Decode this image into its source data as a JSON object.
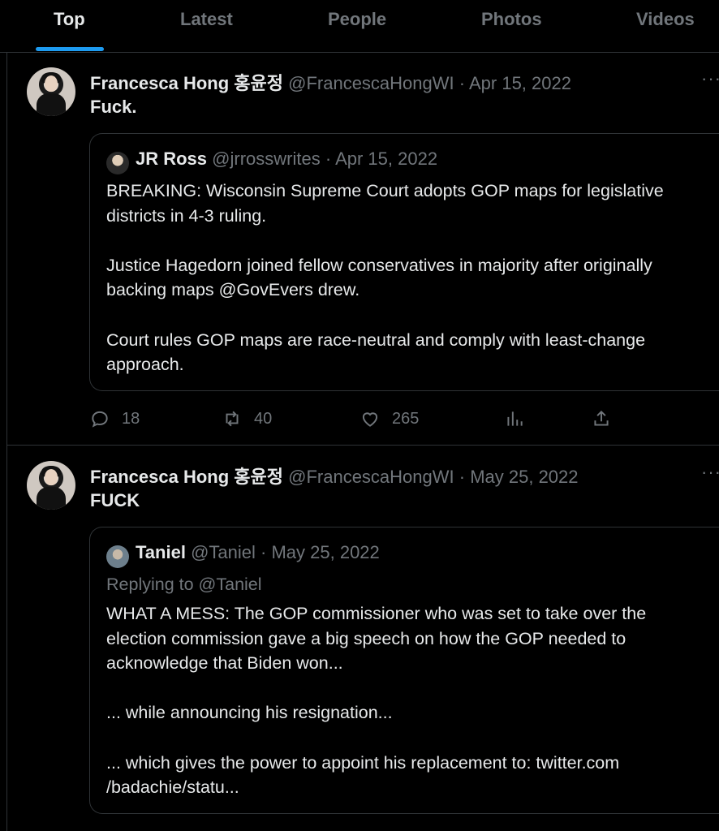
{
  "tabs": [
    {
      "label": "Top",
      "active": true
    },
    {
      "label": "Latest",
      "active": false
    },
    {
      "label": "People",
      "active": false
    },
    {
      "label": "Photos",
      "active": false
    },
    {
      "label": "Videos",
      "active": false
    }
  ],
  "tweets": [
    {
      "author_name": "Francesca Hong 홍윤정",
      "author_handle": "@FrancescaHongWI",
      "date": "· Apr 15, 2022",
      "text": "Fuck.",
      "more": "···",
      "quote": {
        "author_name": "JR Ross",
        "author_handle": "@jrrosswrites",
        "date": "· Apr 15, 2022",
        "body": "BREAKING: Wisconsin Supreme Court adopts GOP maps for legislative\ndistricts in 4-3 ruling.\n\nJustice Hagedorn joined fellow conservatives in majority after originally\nbacking maps @GovEvers drew.\n\nCourt rules GOP maps are race-neutral and comply with least-change\napproach."
      },
      "actions": {
        "replies": "18",
        "retweets": "40",
        "likes": "265"
      }
    },
    {
      "author_name": "Francesca Hong 홍윤정",
      "author_handle": "@FrancescaHongWI",
      "date": "· May 25, 2022",
      "text": "FUCK",
      "more": "···",
      "quote": {
        "author_name": "Taniel",
        "author_handle": "@Taniel",
        "date": "· May 25, 2022",
        "replying_to": "Replying to @Taniel",
        "body": "WHAT A MESS: The GOP commissioner who was set to take over the\nelection commission gave a big speech on how the GOP needed to\nacknowledge that Biden won...\n\n... while announcing his resignation...\n\n... which gives the power to appoint his replacement to: twitter.com\n/badachie/statu..."
      }
    }
  ],
  "icons": {
    "reply": "reply-icon",
    "retweet": "retweet-icon",
    "like": "like-icon",
    "views": "views-icon",
    "share": "share-icon"
  },
  "colors": {
    "accent": "#1d9bf0",
    "text": "#e7e9ea",
    "muted": "#71767b",
    "border": "#2f3336",
    "background": "#000000"
  }
}
